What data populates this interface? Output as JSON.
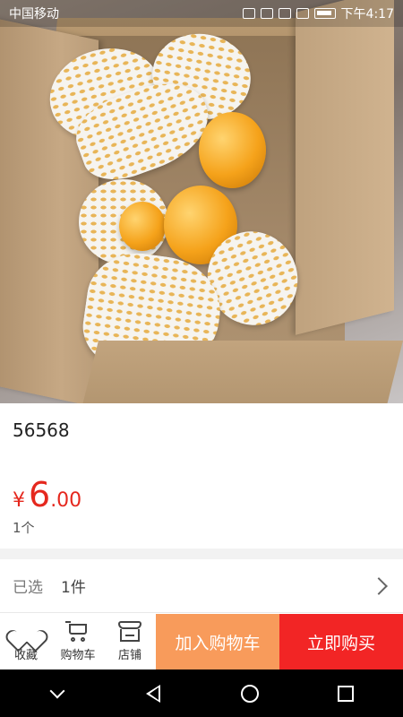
{
  "status_bar": {
    "carrier": "中国移动",
    "time": "下午4:17",
    "icons": [
      "mute-icon",
      "sim-icon",
      "wifi-icon",
      "signal-icon",
      "battery-icon"
    ]
  },
  "product": {
    "image_icon": "product-photo",
    "name": "56568",
    "price_symbol": "¥",
    "price_integer": "6",
    "price_decimal": ".00",
    "unit": "1个"
  },
  "selection": {
    "label": "已选",
    "value": "1件"
  },
  "action_bar": {
    "favorite_label": "收藏",
    "cart_label": "购物车",
    "shop_label": "店铺",
    "add_to_cart_label": "加入购物车",
    "buy_now_label": "立即购买"
  },
  "colors": {
    "price": "#e5281e",
    "add_to_cart_bg": "#f89b5b",
    "buy_now_bg": "#f22525"
  },
  "nav_bar": {
    "icons": [
      "hide-keyboard-icon",
      "back-icon",
      "home-icon",
      "recents-icon"
    ]
  }
}
